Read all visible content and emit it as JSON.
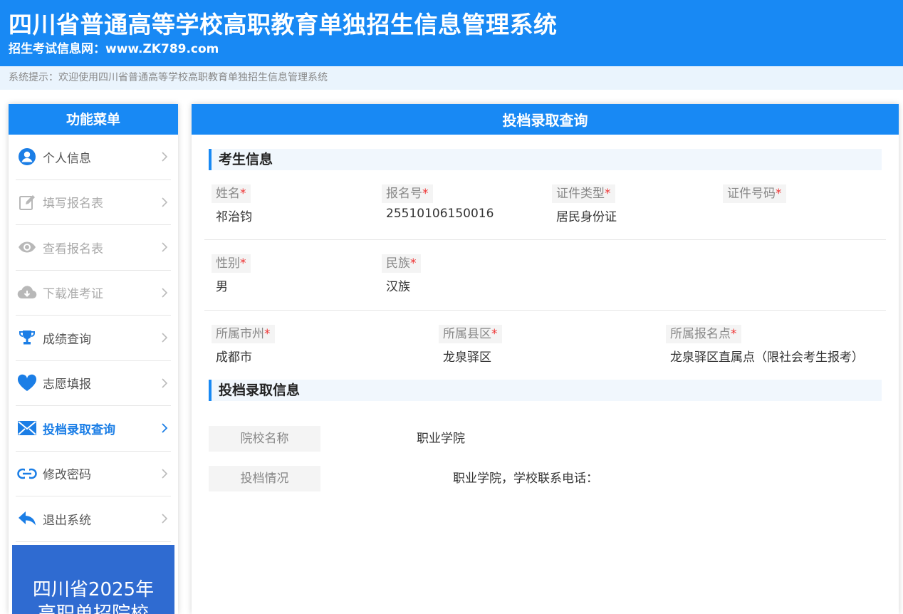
{
  "header": {
    "title": "四川省普通高等学校高职教育单独招生信息管理系统",
    "subtitle": "招生考试信息网：www.ZK789.com"
  },
  "notice": {
    "text": "系统提示：欢迎使用四川省普通高等学校高职教育单独招生信息管理系统"
  },
  "sidebar": {
    "title": "功能菜单",
    "items": [
      {
        "label": "个人信息",
        "icon": "user-icon",
        "state": "normal"
      },
      {
        "label": "填写报名表",
        "icon": "edit-icon",
        "state": "disabled"
      },
      {
        "label": "查看报名表",
        "icon": "eye-icon",
        "state": "disabled"
      },
      {
        "label": "下载准考证",
        "icon": "cloud-download-icon",
        "state": "disabled"
      },
      {
        "label": "成绩查询",
        "icon": "trophy-icon",
        "state": "normal"
      },
      {
        "label": "志愿填报",
        "icon": "heart-icon",
        "state": "normal"
      },
      {
        "label": "投档录取查询",
        "icon": "envelope-icon",
        "state": "active"
      },
      {
        "label": "修改密码",
        "icon": "link-icon",
        "state": "normal"
      },
      {
        "label": "退出系统",
        "icon": "reply-icon",
        "state": "normal"
      }
    ],
    "banner": {
      "line1": "四川省2025年",
      "line2": "高职单招院校"
    }
  },
  "main": {
    "title": "投档录取查询",
    "student_section": "考生信息",
    "fields": {
      "name": {
        "label": "姓名",
        "value": "祁治钧"
      },
      "reg_no": {
        "label": "报名号",
        "value": "25510106150016"
      },
      "id_type": {
        "label": "证件类型",
        "value": "居民身份证"
      },
      "id_no": {
        "label": "证件号码",
        "value": ""
      },
      "gender": {
        "label": "性别",
        "value": "男"
      },
      "ethnicity": {
        "label": "民族",
        "value": "汉族"
      },
      "city": {
        "label": "所属市州",
        "value": "成都市"
      },
      "county": {
        "label": "所属县区",
        "value": "龙泉驿区"
      },
      "site": {
        "label": "所属报名点",
        "value": "龙泉驿区直属点（限社会考生报考）"
      }
    },
    "required_mark": "*",
    "admission_section": "投档录取信息",
    "admission": {
      "school_label": "院校名称",
      "school_value": "职业学院",
      "status_label": "投档情况",
      "status_value": "职业学院，学校联系电话："
    }
  },
  "colors": {
    "primary": "#1889f4",
    "active_menu": "#1b7ee6",
    "required": "#ee3333",
    "banner": "#2f6bd1"
  }
}
